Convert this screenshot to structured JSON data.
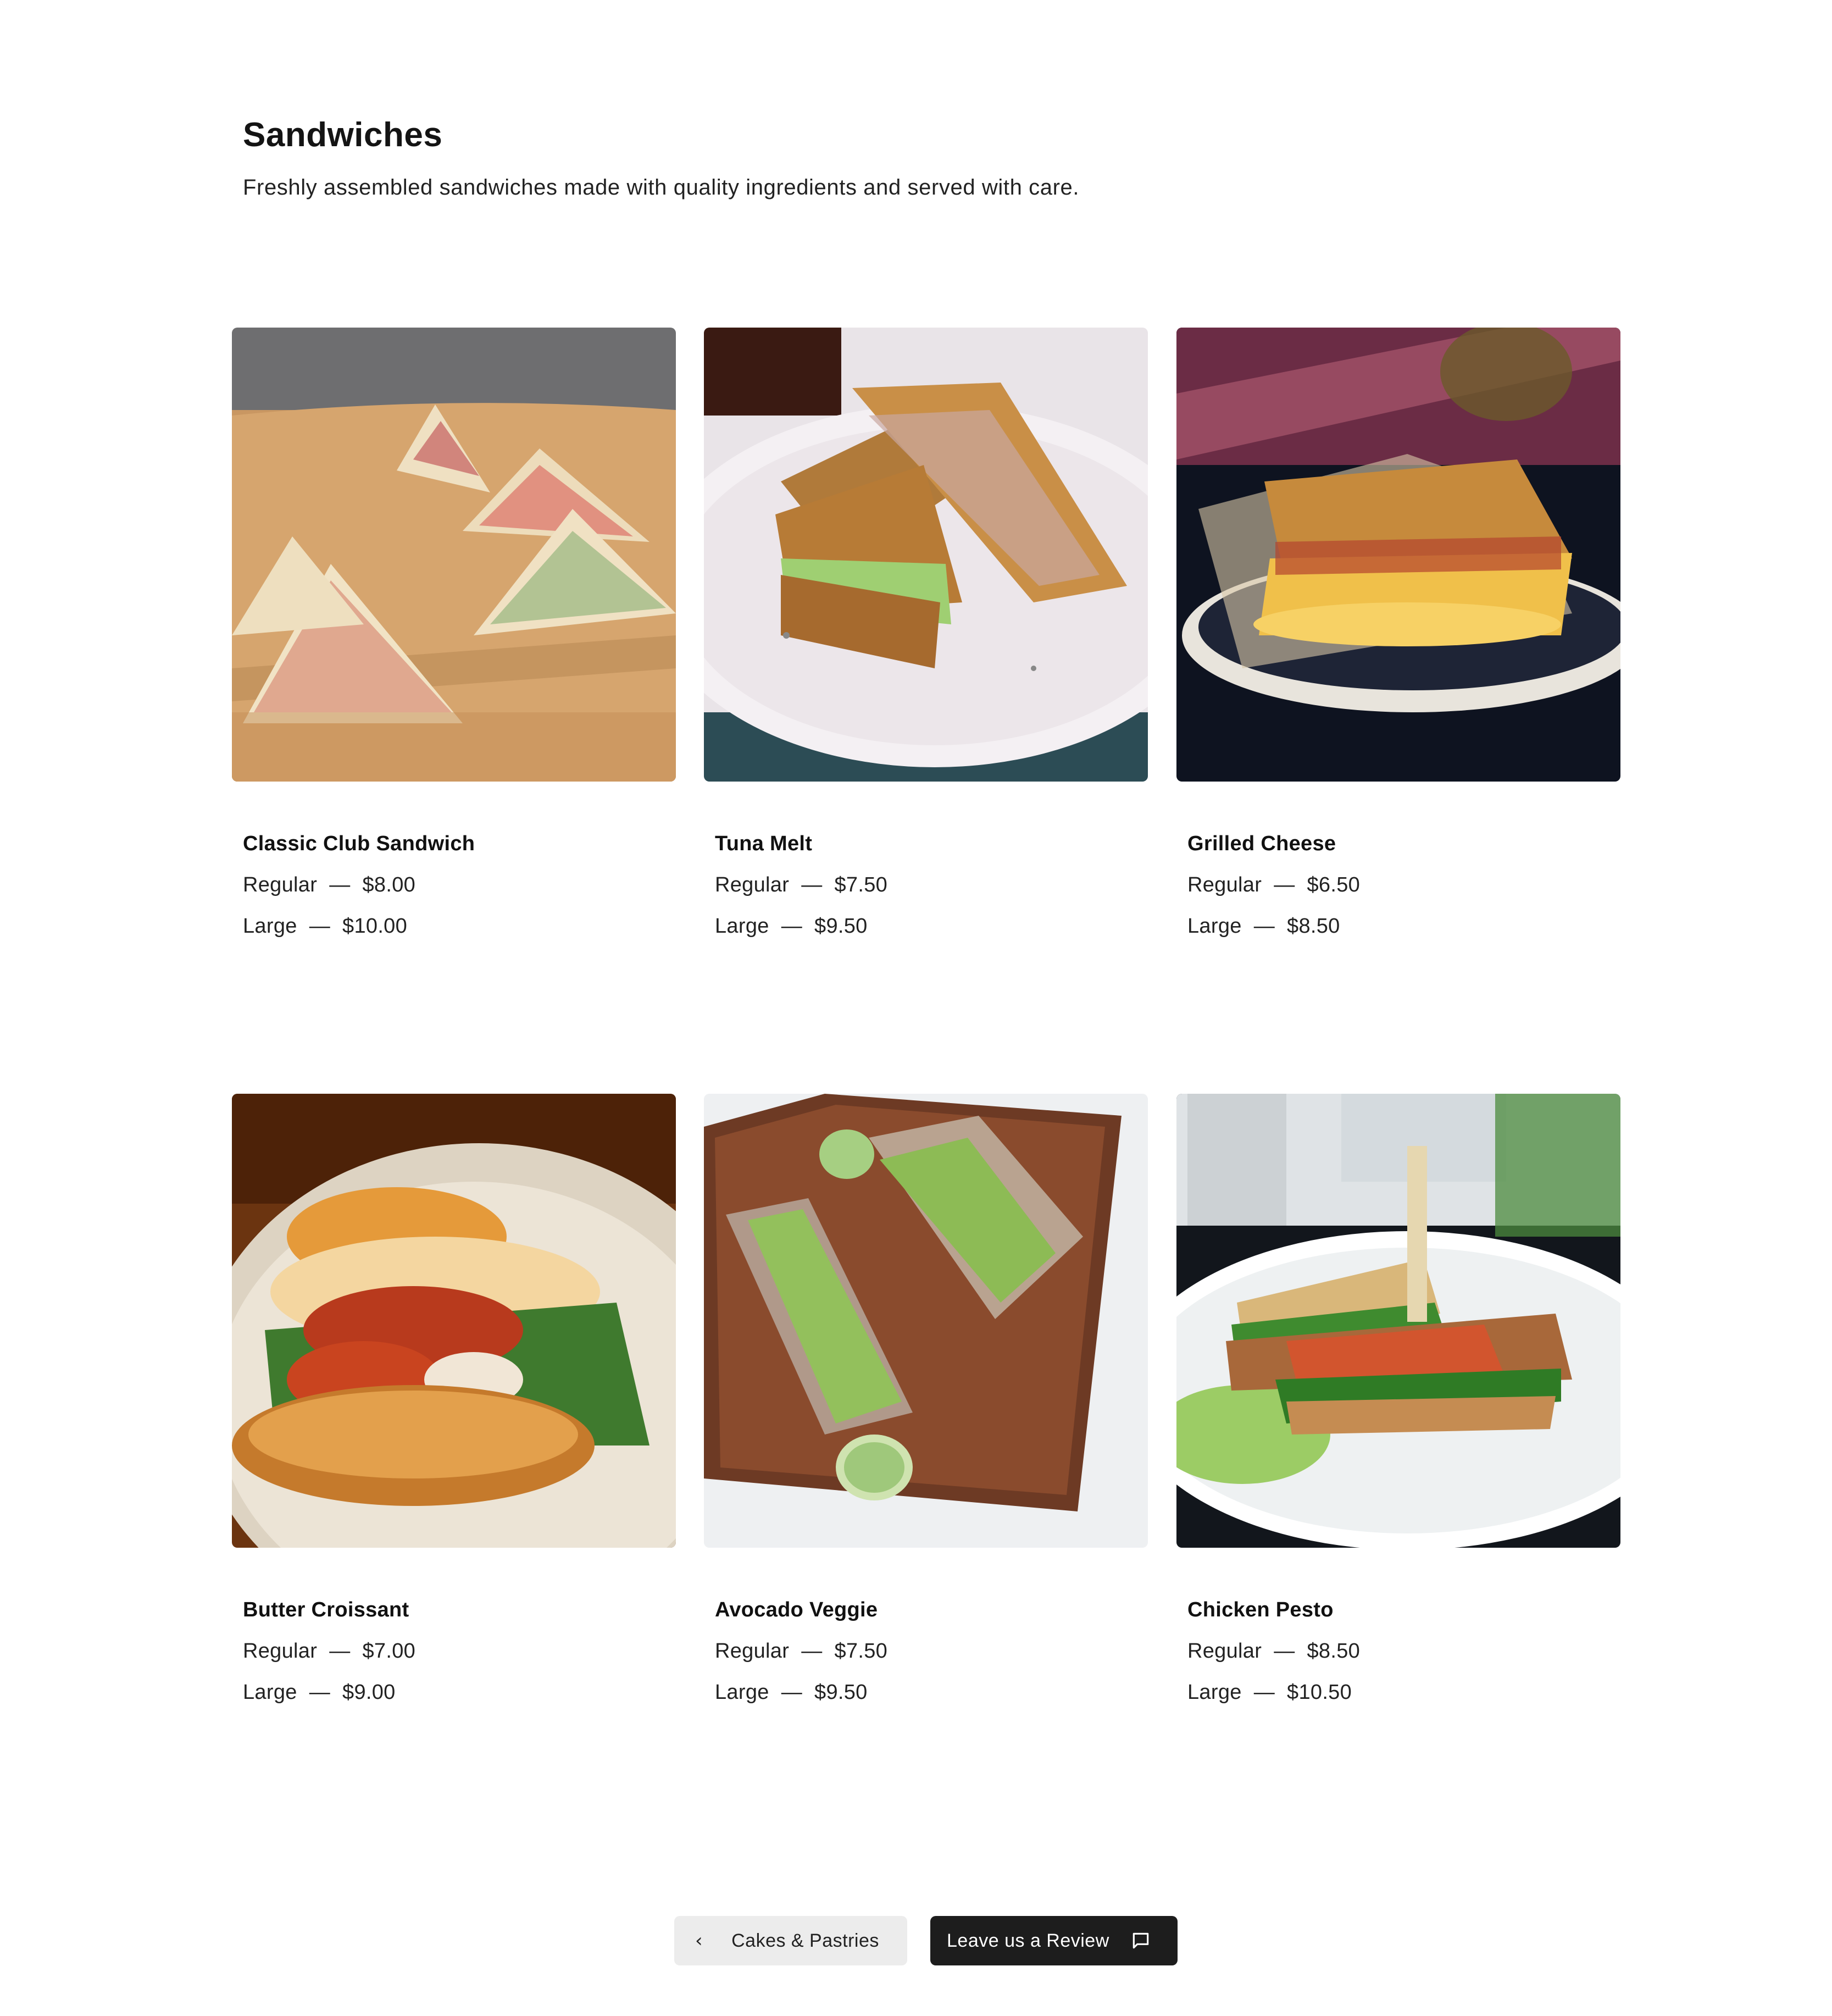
{
  "header": {
    "title": "Sandwiches",
    "subtitle": "Freshly assembled sandwiches made with quality ingredients and served with care."
  },
  "items": [
    {
      "name": "Classic Club Sandwich",
      "regular_label": "Regular",
      "regular_price": "$8.00",
      "large_label": "Large",
      "large_price": "$10.00"
    },
    {
      "name": "Tuna Melt",
      "regular_label": "Regular",
      "regular_price": "$7.50",
      "large_label": "Large",
      "large_price": "$9.50"
    },
    {
      "name": "Grilled Cheese",
      "regular_label": "Regular",
      "regular_price": "$6.50",
      "large_label": "Large",
      "large_price": "$8.50"
    },
    {
      "name": "Butter Croissant",
      "regular_label": "Regular",
      "regular_price": "$7.00",
      "large_label": "Large",
      "large_price": "$9.00"
    },
    {
      "name": "Avocado Veggie",
      "regular_label": "Regular",
      "regular_price": "$7.50",
      "large_label": "Large",
      "large_price": "$9.50"
    },
    {
      "name": "Chicken Pesto",
      "regular_label": "Regular",
      "regular_price": "$8.50",
      "large_label": "Large",
      "large_price": "$10.50"
    }
  ],
  "separator": "—",
  "nav": {
    "prev_label": "Cakes & Pastries",
    "prev_icon": "chevron-left-icon",
    "review_label": "Leave us a Review",
    "review_icon": "message-square-icon"
  },
  "colors": {
    "text": "#1a1a1a",
    "prev_button_bg": "#ececec",
    "review_button_bg": "#1d1d1d"
  }
}
